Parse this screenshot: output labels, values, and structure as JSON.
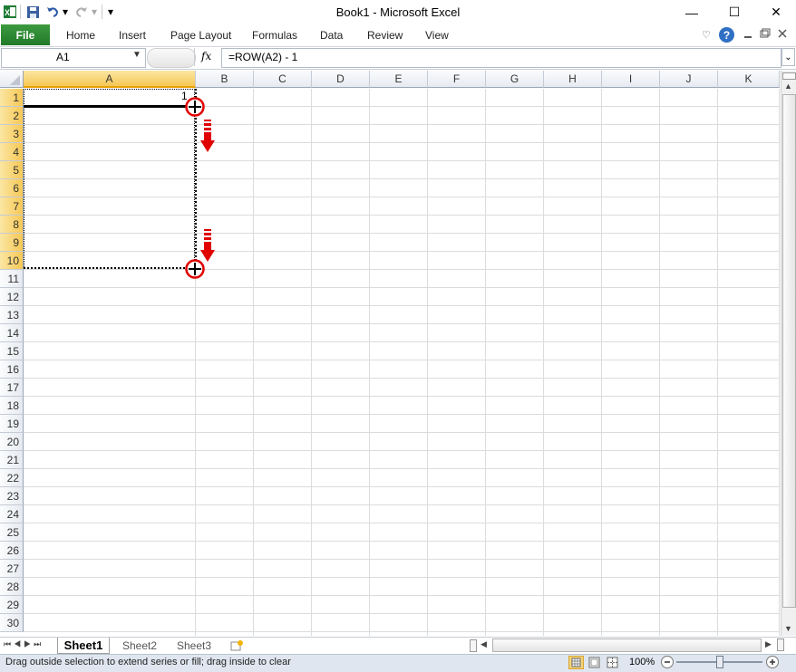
{
  "window": {
    "title": "Book1 - Microsoft Excel"
  },
  "qat": {
    "undo_arrow": "▾",
    "customize": "▾"
  },
  "window_controls": {
    "minimize": "—",
    "maximize": "☐",
    "close": "✕"
  },
  "ribbon": {
    "file_label": "File",
    "tabs": [
      "Home",
      "Insert",
      "Page Layout",
      "Formulas",
      "Data",
      "Review",
      "View"
    ],
    "help": "?"
  },
  "formula_bar": {
    "name_box": "A1",
    "fx_label": "fx",
    "formula": "=ROW(A2) - 1"
  },
  "grid": {
    "columns": [
      "A",
      "B",
      "C",
      "D",
      "E",
      "F",
      "G",
      "H",
      "I",
      "J",
      "K"
    ],
    "rows": [
      "1",
      "2",
      "3",
      "4",
      "5",
      "6",
      "7",
      "8",
      "9",
      "10",
      "11",
      "12",
      "13",
      "14",
      "15",
      "16",
      "17",
      "18",
      "19",
      "20",
      "21",
      "22",
      "23",
      "24",
      "25",
      "26",
      "27",
      "28",
      "29",
      "30"
    ],
    "cell_a1_value": "1",
    "selected_column": "A",
    "selected_rows": [
      "1",
      "2",
      "3",
      "4",
      "5",
      "6",
      "7",
      "8",
      "9",
      "10"
    ]
  },
  "sheets": {
    "tabs": [
      "Sheet1",
      "Sheet2",
      "Sheet3"
    ],
    "active": "Sheet1"
  },
  "status": {
    "message": "Drag outside selection to extend series or fill; drag inside to clear",
    "zoom": "100%"
  },
  "colors": {
    "accent_file": "#217a29",
    "annotation_red": "#e00000",
    "header_selected": "#f6c855"
  },
  "icons": {
    "excel_logo": "excel-logo-icon",
    "fill_handle_marker": "crosshair-plus-icon",
    "drag_arrow": "down-arrow-icon"
  }
}
